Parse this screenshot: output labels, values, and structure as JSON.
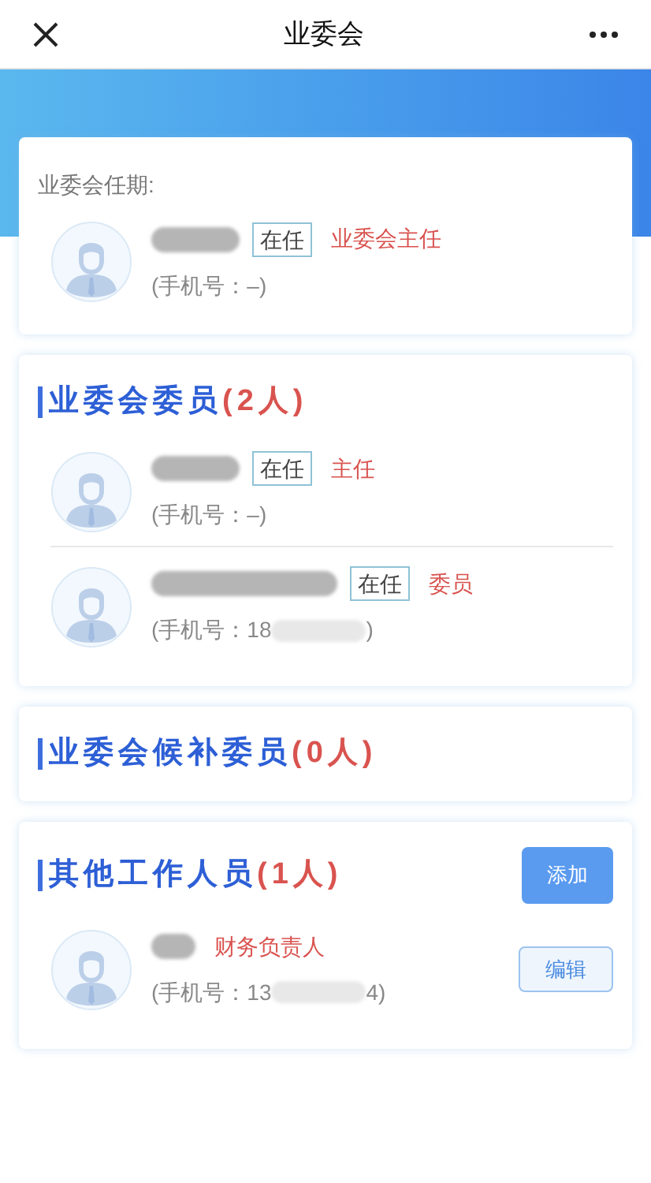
{
  "nav": {
    "title": "业委会"
  },
  "term": {
    "label": "业委会任期:",
    "members": [
      {
        "status": "在任",
        "role": "业委会主任",
        "phone_prefix": "(手机号：–)"
      }
    ]
  },
  "sections": [
    {
      "title": "业委会委员",
      "count": "(2人)",
      "members": [
        {
          "status": "在任",
          "role": "主任",
          "phone_prefix": "(手机号：–)"
        },
        {
          "status": "在任",
          "role": "委员",
          "phone_prefix": "(手机号：18",
          "phone_suffix": ")"
        }
      ]
    },
    {
      "title": "业委会候补委员",
      "count": "(0人)"
    },
    {
      "title": "其他工作人员",
      "count": "(1人)",
      "action": "添加",
      "members": [
        {
          "role": "财务负责人",
          "phone_prefix": "(手机号：13",
          "phone_suffix": "4)",
          "edit": "编辑"
        }
      ]
    }
  ]
}
